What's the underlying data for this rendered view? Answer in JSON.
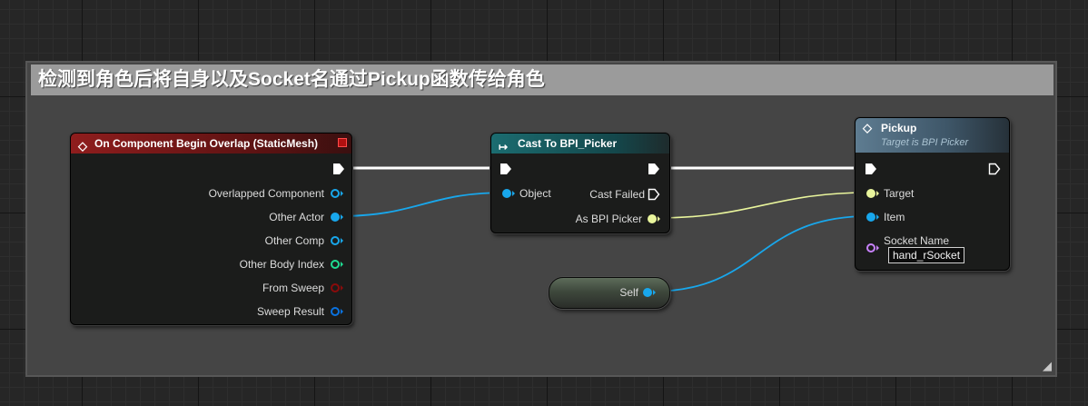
{
  "comment": {
    "title": "检测到角色后将自身以及Socket名通过Pickup函数传给角色"
  },
  "colors": {
    "event_header": "#8a1d1d",
    "cast_header": "#1b6c70",
    "function_header": "#5e7c91",
    "object_pin": "#18a7ec",
    "interface_pin": "#e9f59c",
    "struct_pin": "#0a72e0",
    "int_pin": "#1fdc92",
    "bool_pin": "#8a0b0b",
    "name_pin": "#c882ff",
    "exec_wire": "#ffffff"
  },
  "event_node": {
    "title": "On Component Begin Overlap (StaticMesh)",
    "icon": "event-diamond-icon",
    "pins": [
      "Overlapped Component",
      "Other Actor",
      "Other Comp",
      "Other Body Index",
      "From Sweep",
      "Sweep Result"
    ]
  },
  "cast_node": {
    "title": "Cast To BPI_Picker",
    "icon": "cast-arrow-icon",
    "input_pin": "Object",
    "cast_failed_pin": "Cast Failed",
    "output_pin": "As BPI Picker"
  },
  "pickup_node": {
    "title": "Pickup",
    "subtitle": "Target is BPI Picker",
    "icon": "function-diamond-icon",
    "target_pin": "Target",
    "item_pin": "Item",
    "socket_pin": "Socket Name",
    "socket_value": "hand_rSocket"
  },
  "self_node": {
    "label": "Self"
  }
}
